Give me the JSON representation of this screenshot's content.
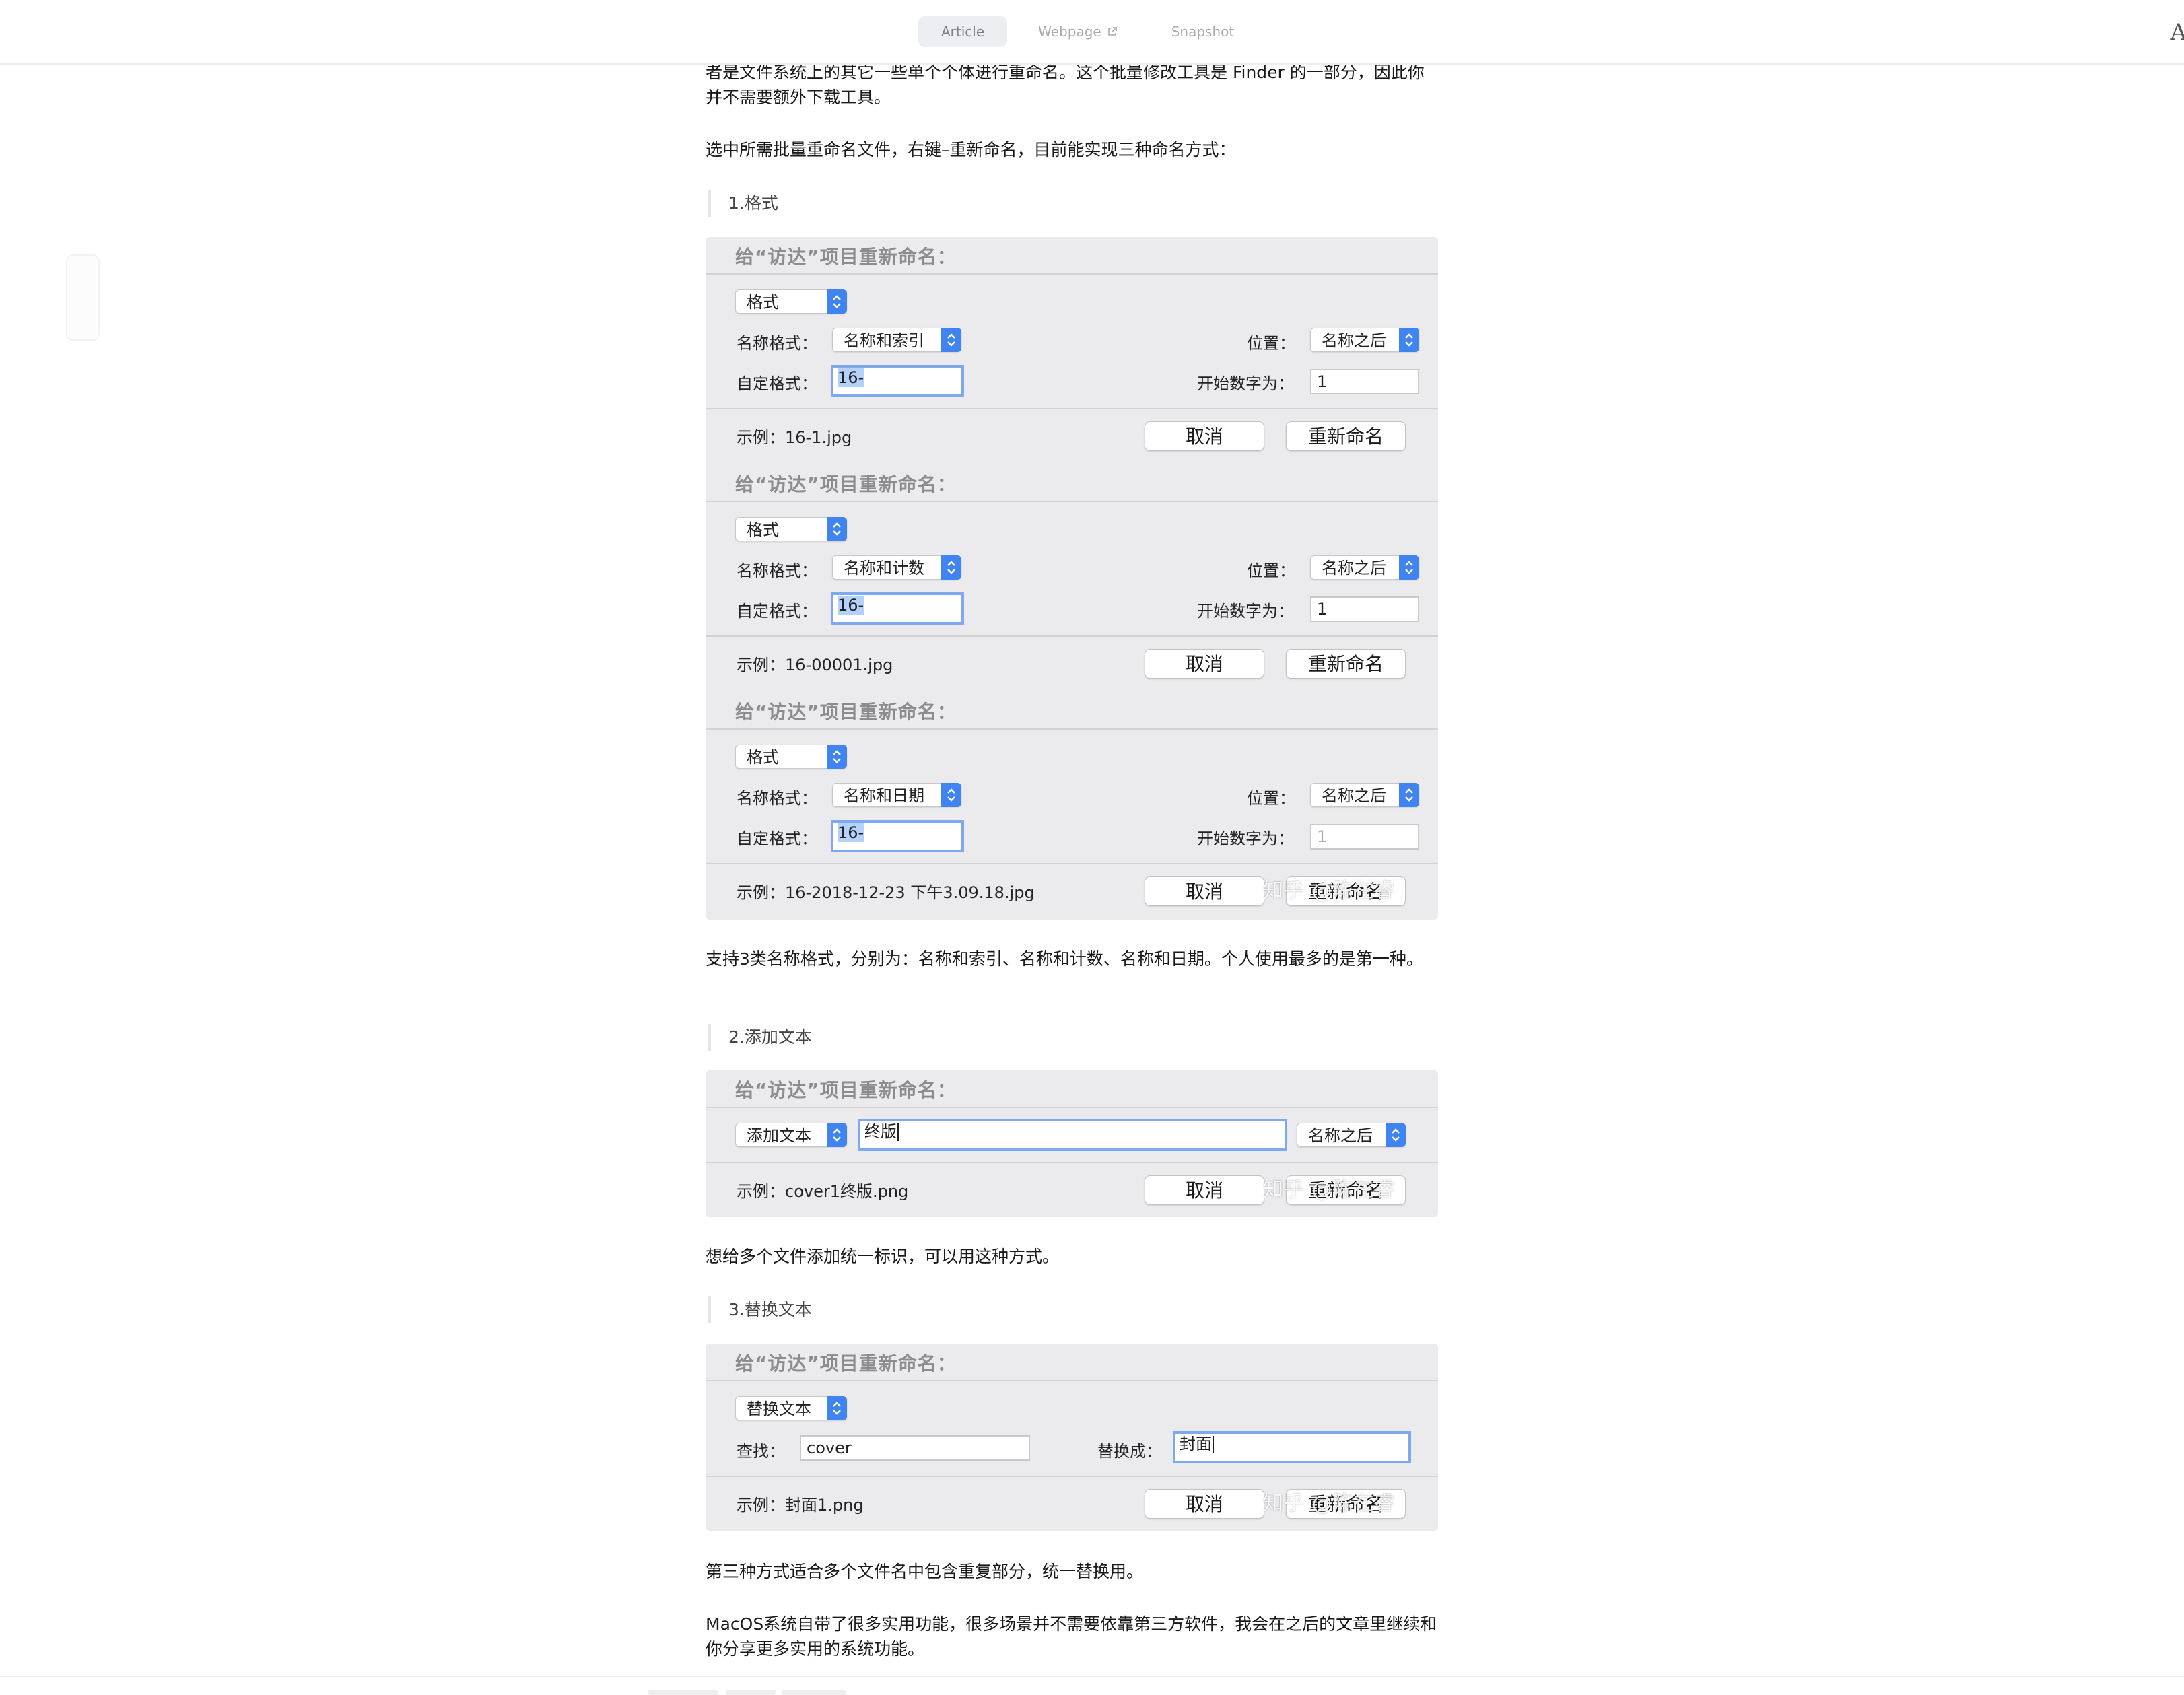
{
  "topbar": {
    "tabs": [
      {
        "label": "Article",
        "active": true
      },
      {
        "label": "Webpage",
        "active": false,
        "icon": "external-link-icon"
      },
      {
        "label": "Snapshot",
        "active": false
      }
    ],
    "corner_letter": "A"
  },
  "article": {
    "intro": "者是文件系统上的其它一些单个个体进行重命名。这个批量修改工具是 Finder 的一部分，因此你并不需要额外下载工具。",
    "select_text": "选中所需批量重命名文件，右键–重新命名，目前能实现三种命名方式：",
    "section1_label": "1.格式",
    "format_summary": "支持3类名称格式，分别为：名称和索引、名称和计数、名称和日期。个人使用最多的是第一种。",
    "section2_label": "2.添加文本",
    "add_text_summary": "想给多个文件添加统一标识，可以用这种方式。",
    "section3_label": "3.替换文本",
    "replace_summary": "第三种方式适合多个文件名中包含重复部分，统一替换用。",
    "closing": "MacOS系统自带了很多实用功能，很多场景并不需要依靠第三方软件，我会在之后的文章里继续和你分享更多实用的系统功能。"
  },
  "dialogs": {
    "title": "给“访达”项目重新命名：",
    "cancel_label": "取消",
    "rename_label": "重新命名",
    "watermark": "知乎 @陈在睿",
    "mode_format": "格式",
    "mode_add": "添加文本",
    "mode_replace": "替换文本",
    "name_format_label": "名称格式：",
    "custom_format_label": "自定格式：",
    "position_label": "位置：",
    "start_number_label": "开始数字为：",
    "find_label": "查找：",
    "replace_with_label": "替换成：",
    "format_index": {
      "name_format": "名称和索引",
      "custom_format": "16-",
      "position": "名称之后",
      "start_number": "1",
      "example": "示例：16-1.jpg"
    },
    "format_count": {
      "name_format": "名称和计数",
      "custom_format": "16-",
      "position": "名称之后",
      "start_number": "1",
      "example": "示例：16-00001.jpg"
    },
    "format_date": {
      "name_format": "名称和日期",
      "custom_format": "16-",
      "position": "名称之后",
      "start_number": "1",
      "example": "示例：16-2018-12-23 下午3.09.18.jpg"
    },
    "add_text": {
      "text": "终版",
      "position": "名称之后",
      "example": "示例：cover1终版.png"
    },
    "replace_text": {
      "find": "cover",
      "replace_with": "封面",
      "example": "示例：封面1.png"
    }
  }
}
